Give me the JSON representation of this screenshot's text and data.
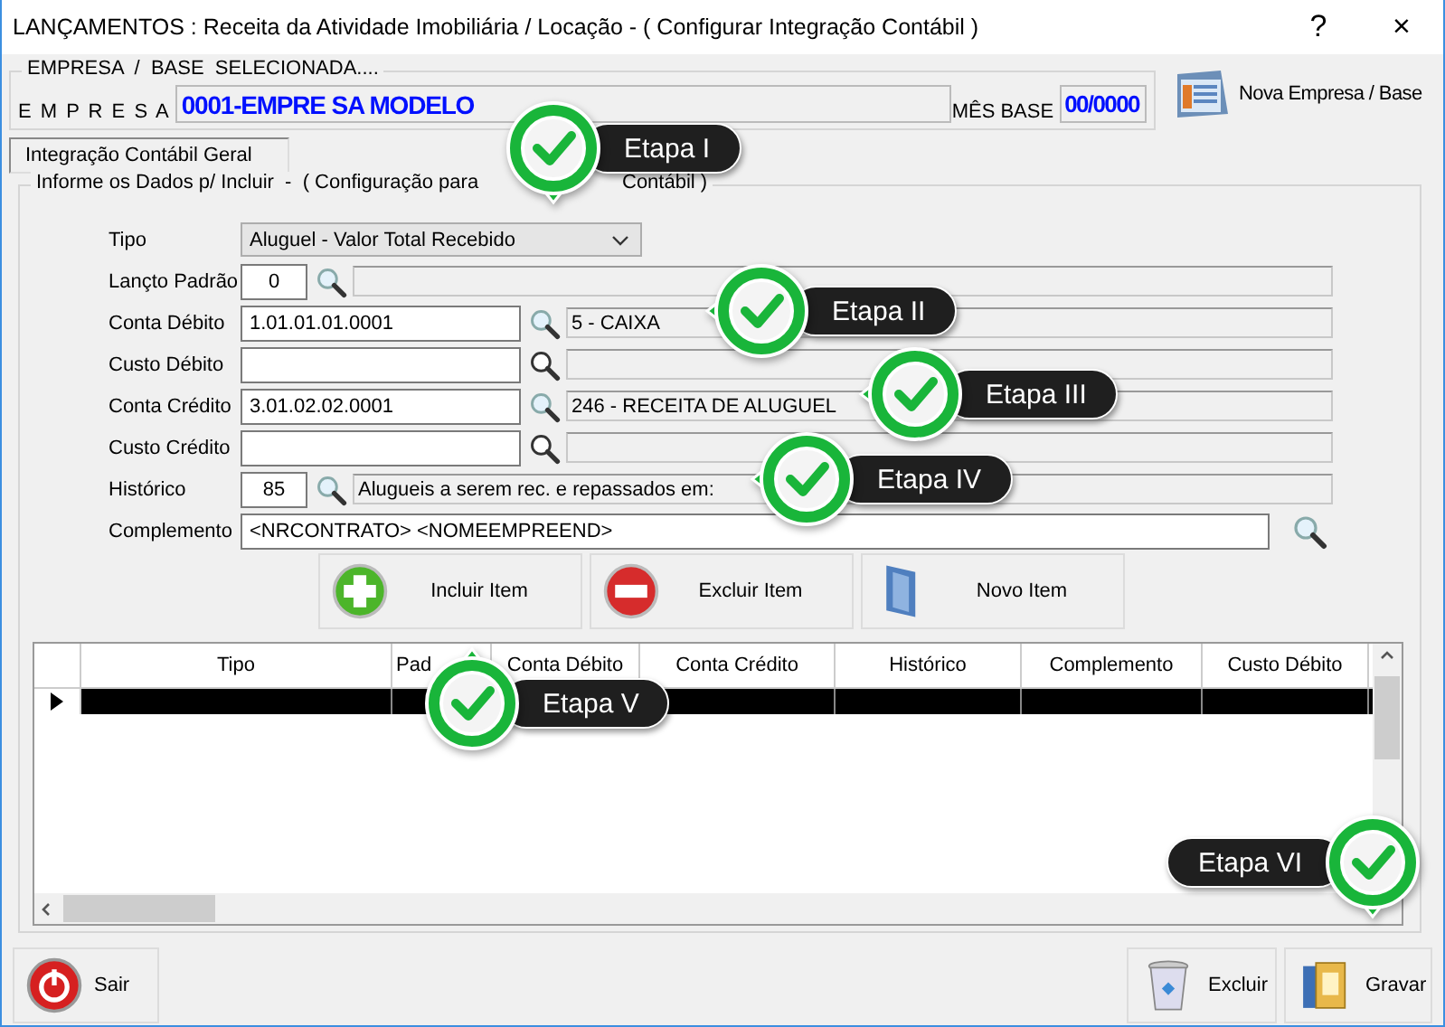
{
  "window": {
    "title": "LANÇAMENTOS : Receita da Atividade Imobiliária / Locação - ( Configurar Integração Contábil )",
    "help": "?",
    "close": "×"
  },
  "empresa": {
    "legend": "EMPRESA  /  BASE  SELECIONADA....",
    "label": "E M P R E S A",
    "value": "0001-EMPRE SA MODELO",
    "mes_label": "MÊS BASE",
    "mes_value": "00/0000",
    "new_button": "Nova Empresa / Base"
  },
  "tabs": [
    {
      "label": "Integração Contábil Geral",
      "selected": true
    }
  ],
  "form": {
    "legend": "Informe os Dados p/ Incluir  -  ( Configuração para",
    "legend_tail": "Contábil )",
    "fields": [
      {
        "kind": "select",
        "label": "Tipo",
        "value": "Aluguel - Valor Total Recebido"
      },
      {
        "kind": "code",
        "label": "Lançto Padrão",
        "value": "0"
      },
      {
        "kind": "account",
        "label": "Conta Débito",
        "value": "1.01.01.01.0001",
        "description": "5 - CAIXA"
      },
      {
        "kind": "account",
        "label": "Custo Débito"
      },
      {
        "kind": "account",
        "label": "Conta Crédito",
        "value": "3.01.02.02.0001",
        "description": "246 - RECEITA DE ALUGUEL"
      },
      {
        "kind": "account",
        "label": "Custo Crédito"
      },
      {
        "kind": "code",
        "label": "Histórico",
        "value": "85",
        "description": "Alugueis a serem rec. e repassados em:"
      },
      {
        "kind": "text",
        "label": "Complemento",
        "value": "<NRCONTRATO> <NOMEEMPREEND>"
      }
    ],
    "buttons": [
      {
        "kind": "add",
        "label": "Incluir Item"
      },
      {
        "kind": "remove",
        "label": "Excluir Item"
      },
      {
        "kind": "new",
        "label": "Novo Item"
      }
    ]
  },
  "grid": {
    "columns": [
      {
        "label": "Tipo"
      },
      {
        "label": "Pad"
      },
      {
        "label": "Conta Débito"
      },
      {
        "label": "Conta Crédito"
      },
      {
        "label": "Histórico"
      },
      {
        "label": "Complemento"
      },
      {
        "label": "Custo Débito"
      }
    ],
    "rows": [
      {
        "selected": true
      }
    ]
  },
  "footer": [
    {
      "kind": "exit",
      "label": "Sair"
    },
    {
      "kind": "delete",
      "label": "Excluir"
    },
    {
      "kind": "save",
      "label": "Gravar"
    }
  ],
  "callouts": [
    {
      "label": "Etapa I"
    },
    {
      "label": "Etapa II"
    },
    {
      "label": "Etapa III"
    },
    {
      "label": "Etapa IV"
    },
    {
      "label": "Etapa V"
    },
    {
      "label": "Etapa VI"
    }
  ]
}
